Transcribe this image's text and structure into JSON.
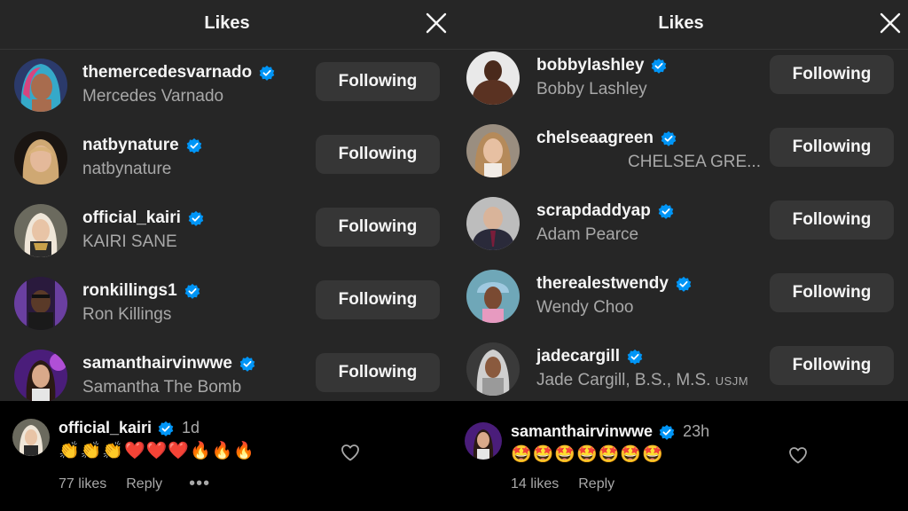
{
  "colors": {
    "sheet_bg": "#262626",
    "button_bg": "#363636",
    "verified": "#0095f6",
    "secondary_text": "#a8a8a8"
  },
  "left_panel": {
    "title": "Likes",
    "close_icon": "close-icon",
    "users": [
      {
        "username": "themercedesvarnado",
        "full_name": "Mercedes Varnado",
        "button": "Following",
        "verified": true
      },
      {
        "username": "natbynature",
        "full_name": "natbynature",
        "button": "Following",
        "verified": true
      },
      {
        "username": "official_kairi",
        "full_name": "KAIRI SANE",
        "button": "Following",
        "verified": true
      },
      {
        "username": "ronkillings1",
        "full_name": "Ron Killings",
        "button": "Following",
        "verified": true
      },
      {
        "username": "samanthairvinwwe",
        "full_name": "Samantha The Bomb",
        "button": "Following",
        "verified": true
      }
    ],
    "comment": {
      "username": "official_kairi",
      "time": "1d",
      "text": "👏👏👏❤️❤️❤️🔥🔥🔥",
      "likes": "77 likes",
      "reply": "Reply",
      "more": "•••"
    }
  },
  "right_panel": {
    "title": "Likes",
    "close_icon": "close-icon",
    "users": [
      {
        "username": "bobbylashley",
        "full_name": "Bobby Lashley",
        "button": "Following",
        "verified": true
      },
      {
        "username": "chelseaagreen",
        "full_name": "CHELSEA GRE...",
        "button": "Following",
        "verified": true
      },
      {
        "username": "scrapdaddyap",
        "full_name": "Adam Pearce",
        "button": "Following",
        "verified": true
      },
      {
        "username": "therealestwendy",
        "full_name": "Wendy Choo",
        "button": "Following",
        "verified": true
      },
      {
        "username": "jadecargill",
        "full_name": "Jade Cargill, B.S., M.S.",
        "full_name_suffix": "USJM",
        "button": "Following",
        "verified": true
      }
    ],
    "comment": {
      "username": "samanthairvinwwe",
      "time": "23h",
      "text": "🤩🤩🤩🤩🤩🤩🤩",
      "likes": "14 likes",
      "reply": "Reply"
    }
  }
}
